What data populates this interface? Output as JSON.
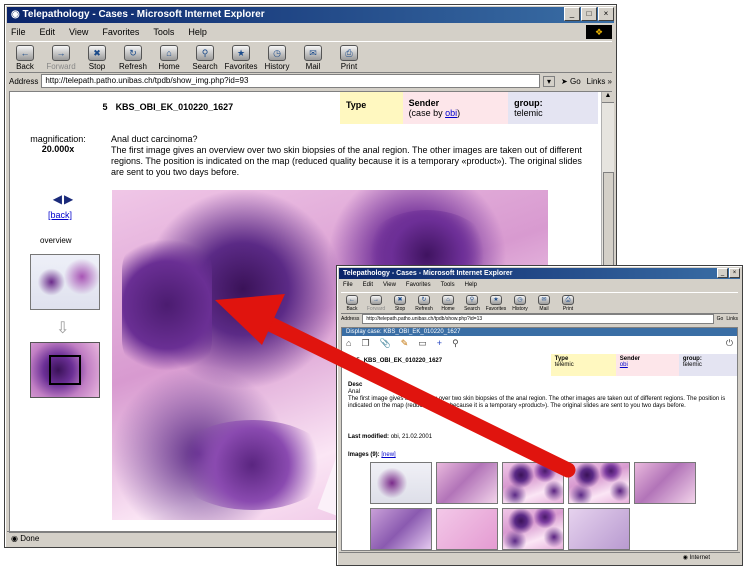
{
  "main_window": {
    "title": "Telepathology - Cases - Microsoft Internet Explorer",
    "menu": [
      "File",
      "Edit",
      "View",
      "Favorites",
      "Tools",
      "Help"
    ],
    "toolbar": [
      "Back",
      "Forward",
      "Stop",
      "Refresh",
      "Home",
      "Search",
      "Favorites",
      "History",
      "Mail",
      "Print"
    ],
    "address_label": "Address",
    "address": "http://telepath.patho.unibas.ch/tpdb/show_img.php?id=93",
    "go_label": "Go",
    "links_label": "Links »",
    "status": "Done",
    "case": {
      "number": "5",
      "id": "KBS_OBI_EK_010220_1627",
      "type_label": "Type",
      "sender_label": "Sender",
      "sender_note_prefix": "(case by ",
      "sender_link": "obi",
      "sender_note_suffix": ")",
      "group_label": "group:",
      "group_value": "telemic"
    },
    "magnification_label": "magnification:",
    "magnification_value": "20.000x",
    "question": "Anal duct carcinoma?",
    "description": "The first image gives an overview over two skin biopsies of the anal region. The other images are taken out of different regions. The position is indicated on the map (reduced quality because it is a temporary «product»). The original slides are sent to you two days before.",
    "back_link": "[back]",
    "overview_label": "overview"
  },
  "inset_window": {
    "title": "Telepathology - Cases - Microsoft Internet Explorer",
    "menu": [
      "File",
      "Edit",
      "View",
      "Favorites",
      "Tools",
      "Help"
    ],
    "toolbar": [
      "Back",
      "Forward",
      "Stop",
      "Refresh",
      "Home",
      "Search",
      "Favorites",
      "History",
      "Mail",
      "Print"
    ],
    "address_label": "Address",
    "address": "http://telepath.patho.unibas.ch/tpdb/show.php?id=13",
    "go_label": "Go",
    "links_label": "Links",
    "display_case_label": "Display case: KBS_OBI_EK_010220_1627",
    "case": {
      "number": "5",
      "id": "KBS_OBI_EK_010220_1627",
      "type_label": "Type",
      "type_value": "telemic",
      "sender_label": "Sender",
      "sender_value": "obi",
      "group_label": "group:",
      "group_value": "telemic"
    },
    "desc_label": "Desc",
    "question": "Anal",
    "description": "The first image gives an overview over two skin biopsies of the anal region. The other images are taken out of different regions. The position is indicated on the map (reduced quality because it is a temporary «product»). The original slides are sent to you two days before.",
    "last_modified_label": "Last modified:",
    "last_modified_value": "obi, 21.02.2001",
    "images_label": "Images (9):",
    "images_link": "[new]",
    "image_count": 9,
    "status": "Internet"
  },
  "colors": {
    "titlebar": "#0a246a",
    "type_cell": "#fff8c0",
    "sender_cell": "#fde6ea",
    "group_cell": "#e4e4f2",
    "arrow": "#e0140e",
    "link": "#0000cc"
  }
}
